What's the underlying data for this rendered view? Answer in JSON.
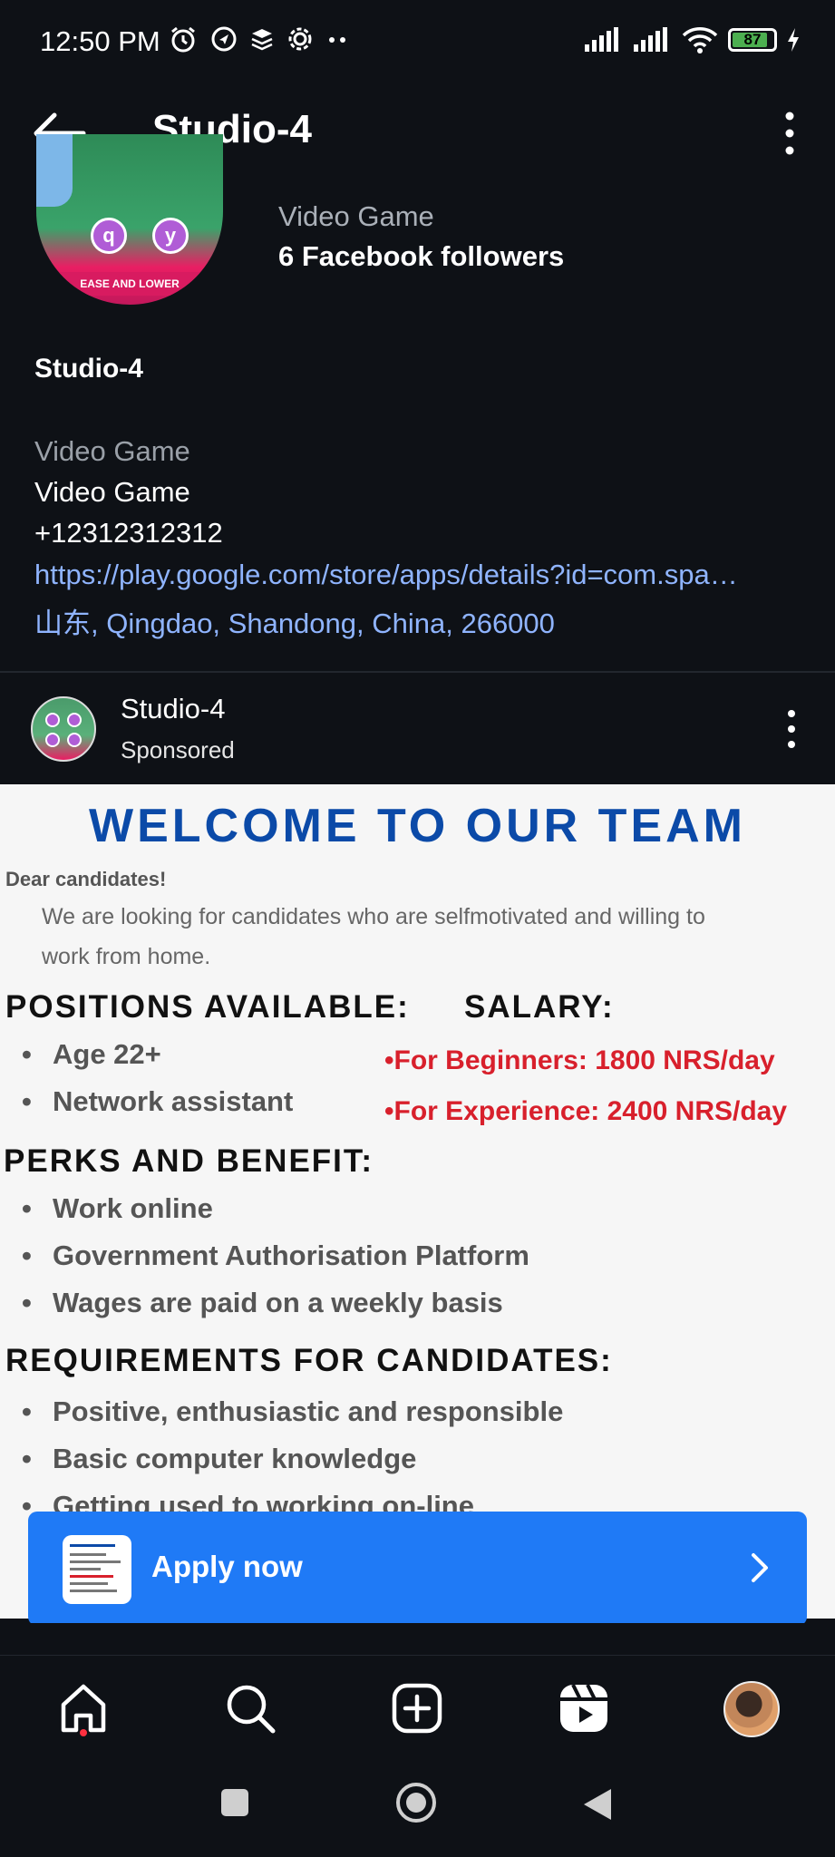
{
  "status_bar": {
    "time": "12:50 PM",
    "battery": "87"
  },
  "header": {
    "title": "Studio-4"
  },
  "profile": {
    "category": "Video Game",
    "followers": "6 Facebook followers",
    "picture_text": {
      "bubble_1": "q",
      "bubble_2": "y",
      "strip": "EASE AND LOWER"
    }
  },
  "page_info": {
    "name": "Studio-4",
    "category_label": "Video Game",
    "category": "Video Game",
    "phone": "+12312312312",
    "link": "https://play.google.com/store/apps/details?id=com.spa…",
    "address": "山东, Qingdao, Shandong, China, 266000"
  },
  "post": {
    "author": "Studio-4",
    "sponsored": "Sponsored"
  },
  "ad": {
    "title": "WELCOME TO OUR TEAM",
    "dear": "Dear candidates!",
    "intro": "We are looking for candidates who are selfmotivated and willing to work from home.",
    "positions_heading": "POSITIONS AVAILABLE:",
    "positions": [
      "Age 22+",
      "Network assistant"
    ],
    "salary_heading": "SALARY:",
    "salary": [
      "For Beginners: 1800 NRS/day",
      "For Experience: 2400 NRS/day"
    ],
    "perks_heading": "PERKS AND BENEFIT:",
    "perks": [
      "Work online",
      "Government Authorisation Platform",
      "Wages are paid on a weekly basis"
    ],
    "requirements_heading": "REQUIREMENTS FOR CANDIDATES:",
    "requirements": [
      "Positive, enthusiastic and responsible",
      "Basic computer knowledge",
      "Getting used to working on-line"
    ]
  },
  "cta": {
    "label": "Apply now"
  },
  "colors": {
    "background": "#0e1116",
    "link": "#8fb4ff",
    "cta": "#1f7af6",
    "ad_title": "#0b4aa8",
    "salary": "#d8202c"
  },
  "icons": [
    "alarm-icon",
    "navigation-icon",
    "layers-icon",
    "settings-icon",
    "signal-icon",
    "wifi-icon",
    "battery-icon",
    "back-arrow-icon",
    "more-vertical-icon",
    "home-icon",
    "search-icon",
    "create-icon",
    "reels-icon",
    "profile-avatar"
  ]
}
